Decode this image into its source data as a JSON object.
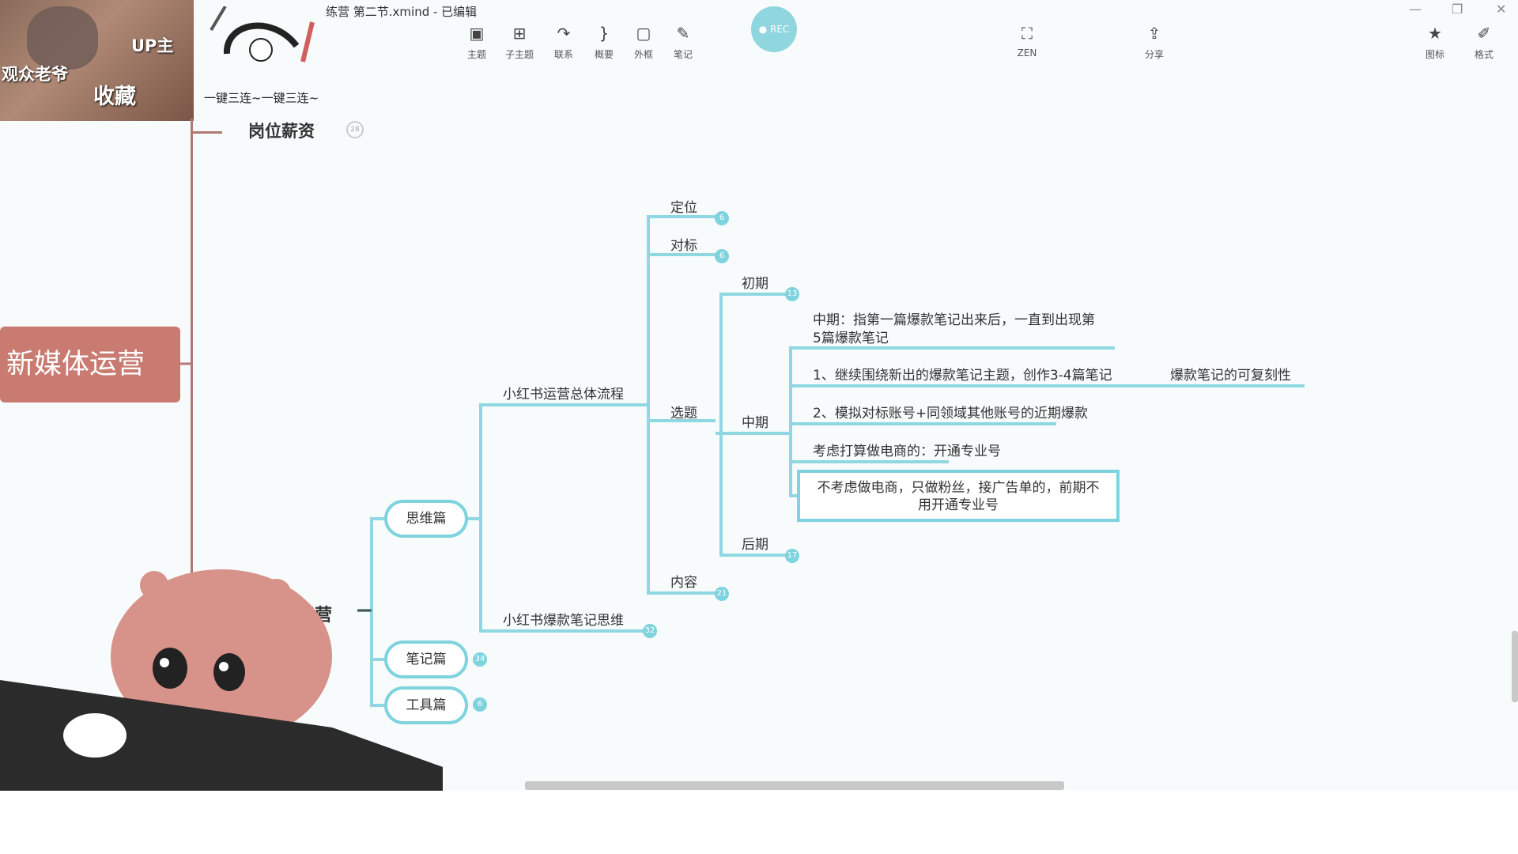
{
  "window": {
    "title": "练营 第二节.xmind - 已编辑"
  },
  "toolbar": {
    "topic": "主题",
    "subtopic": "子主题",
    "relation": "联系",
    "summary": "概要",
    "boundary": "外框",
    "note": "笔记",
    "zen": "ZEN",
    "share": "分享",
    "icon": "图标",
    "format": "格式"
  },
  "overlay": {
    "up": "UP主",
    "viewer": "观众老爷",
    "collect": "收藏",
    "slogan": "一键三连~一键三连~"
  },
  "outline": {
    "salary": "岗位薪资",
    "salary_count": "28",
    "newmedia": "新媒体运营",
    "partial_root": "书运营"
  },
  "map": {
    "thinking": "思维篇",
    "notes": "笔记篇",
    "notes_count": "34",
    "tools": "工具篇",
    "tools_count": "6",
    "flow": "小红书运营总体流程",
    "hot": "小红书爆款笔记思维",
    "hot_count": "32",
    "position": "定位",
    "position_count": "6",
    "benchmark": "对标",
    "benchmark_count": "6",
    "topic": "选题",
    "content": "内容",
    "content_count": "21",
    "early": "初期",
    "early_count": "13",
    "mid": "中期",
    "late": "后期",
    "late_count": "17",
    "mid_desc_1": "中期：指第一篇爆款笔记出来后，一直到出现第",
    "mid_desc_2": "5篇爆款笔记",
    "item1": "1、继续围绕新出的爆款笔记主题，创作3-4篇笔记",
    "item1_tag": "爆款笔记的可复刻性",
    "item2": "2、模拟对标账号+同领域其他账号的近期爆款",
    "item3": "考虑打算做电商的：开通专业号",
    "item4_1": "不考虑做电商，只做粉丝，接广告单的，前期不",
    "item4_2": "用开通专业号"
  },
  "colors": {
    "branch": "#7fd3de",
    "root": "#c97b72"
  }
}
